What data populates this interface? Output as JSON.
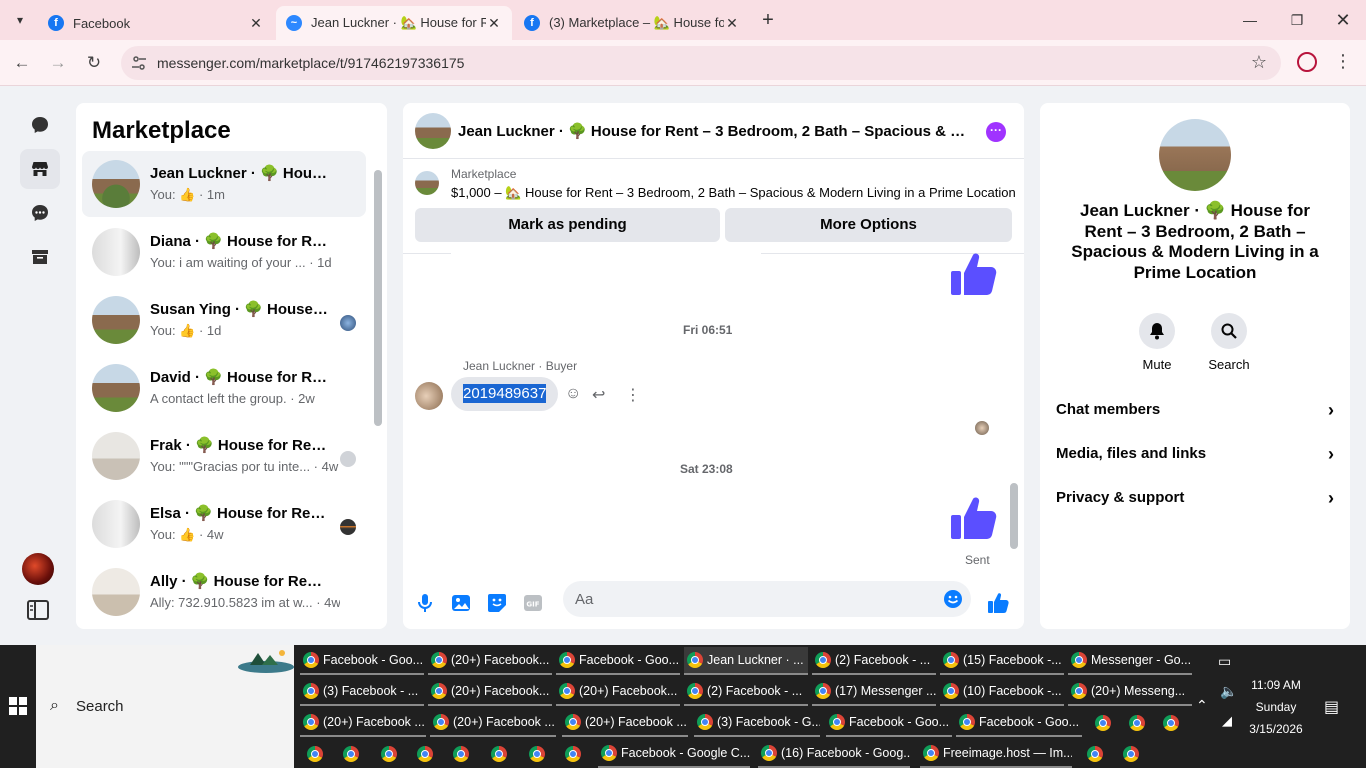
{
  "browser": {
    "tabs": [
      {
        "title": "Facebook",
        "icon": "facebook-icon"
      },
      {
        "title": "Jean Luckner · 🏡 House for Re",
        "icon": "messenger-icon"
      },
      {
        "title": "(3) Marketplace – 🏡 House for",
        "icon": "facebook-icon"
      }
    ],
    "url": "messenger.com/marketplace/t/917462197336175"
  },
  "sidebar_list": {
    "title": "Marketplace",
    "conversations": [
      {
        "name": "Jean Luckner · 🌳 House...",
        "preview": "You: 👍 · 1m"
      },
      {
        "name": "Diana · 🌳 House for Re...",
        "preview": "You: i am waiting of your ... · 1d"
      },
      {
        "name": "Susan Ying · 🌳 House f...",
        "preview": "You: 👍 · 1d"
      },
      {
        "name": "David · 🌳 House for Re...",
        "preview": "A contact left the group. · 2w"
      },
      {
        "name": "Frak · 🌳 House for Rent...",
        "preview": "You: \"\"\"Gracias por tu inte... · 4w"
      },
      {
        "name": "Elsa · 🌳 House for Rent ...",
        "preview": "You: 👍 · 4w"
      },
      {
        "name": "Ally · 🌳 House for Rent ...",
        "preview": "Ally: 732.910.5823 im at w... · 4w"
      }
    ]
  },
  "chat": {
    "header_title": "Jean Luckner · 🌳 House for Rent – 3 Bedroom, 2 Bath – Spacious & Modern Living in a Prime Location",
    "listing_source": "Marketplace",
    "listing_info": "$1,000 – 🏡 House for Rent – 3 Bedroom, 2 Bath – Spacious & Modern Living in a Prime Location",
    "mark_pending": "Mark as pending",
    "more_options": "More Options",
    "day1": "Fri 06:51",
    "sender": "Jean Luckner · Buyer",
    "message": "2019489637",
    "day2": "Sat 23:08",
    "sent_label": "Sent",
    "composer_placeholder": "Aa"
  },
  "info_panel": {
    "title": "Jean Luckner · 🌳 House for Rent – 3 Bedroom, 2 Bath – Spacious & Modern Living in a Prime Location",
    "mute": "Mute",
    "search": "Search",
    "rows": [
      "Chat members",
      "Media, files and links",
      "Privacy & support"
    ]
  },
  "taskbar": {
    "search": "Search",
    "buttons_row1": [
      "Facebook - Goo...",
      "(20+) Facebook...",
      "Facebook - Goo...",
      "Jean Luckner · ...",
      "(2) Facebook - ...",
      "(15) Facebook -...",
      "Messenger - Go..."
    ],
    "buttons_row2": [
      "(3) Facebook - ...",
      "(20+) Facebook...",
      "(20+) Facebook...",
      "(2) Facebook - ...",
      "(17) Messenger ...",
      "(10) Facebook -...",
      "(20+) Messeng..."
    ],
    "buttons_row3": [
      "(20+) Facebook ...",
      "(20+) Facebook ...",
      "(20+) Facebook ...",
      "(3) Facebook - G...",
      "Facebook - Goo...",
      "Facebook - Goo..."
    ],
    "buttons_row4": [
      "Facebook - Google C...",
      "(16) Facebook - Goog...",
      "Freeimage.host — Im..."
    ],
    "time": "11:09 AM",
    "day": "Sunday",
    "date": "3/15/2026"
  },
  "colors": {
    "accent": "#0a7cff",
    "thumbs": "#5b4fff",
    "tabstrip": "#f9dfe4"
  }
}
